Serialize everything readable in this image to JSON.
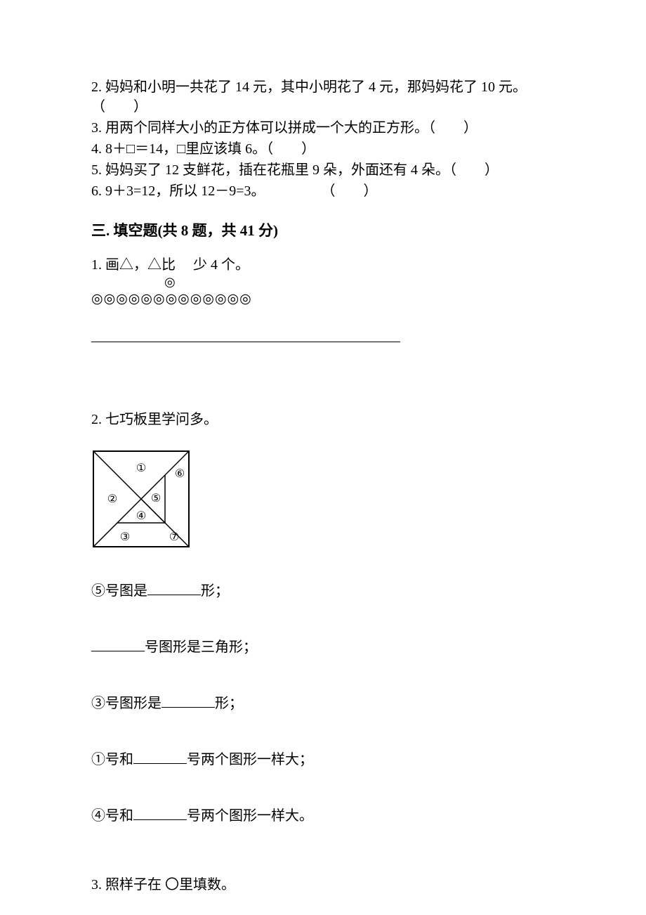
{
  "tf_questions": {
    "q2": "2. 妈妈和小明一共花了 14 元，其中小明花了 4 元，那妈妈花了 10 元。（　　）",
    "q3": "3. 用两个同样大小的正方体可以拼成一个大的正方形。（　　）",
    "q4": "4. 8＋□＝14，□里应该填 6。（　　）",
    "q5": "5. 妈妈买了 12 支鲜花，插在花瓶里 9 朵，外面还有 4 朵。（　　）",
    "q6": "6. 9＋3=12，所以 12－9=3。　　　　　（　　）"
  },
  "section3_heading": "三. 填空题(共 8 题，共 41 分)",
  "q1": {
    "text_line1": "1. 画△，△比　 少 4 个。",
    "symbol": "◎",
    "circle_row_item": "◎",
    "circle_count": 13
  },
  "q2": {
    "title": "2. 七巧板里学问多。",
    "labels": {
      "p1": "①",
      "p2": "②",
      "p3": "③",
      "p4": "④",
      "p5": "⑤",
      "p6": "⑥",
      "p7": "⑦"
    },
    "line1_pre": "⑤号图是",
    "line1_post": "形；",
    "line2_post": "号图形是三角形；",
    "line3_pre": "③号图形是",
    "line3_post": "形；",
    "line4_pre": "①号和",
    "line4_post": "号两个图形一样大；",
    "line5_pre": "④号和",
    "line5_post": "号两个图形一样大。"
  },
  "q3": {
    "text": "3. 照样子在 〇里填数。"
  }
}
